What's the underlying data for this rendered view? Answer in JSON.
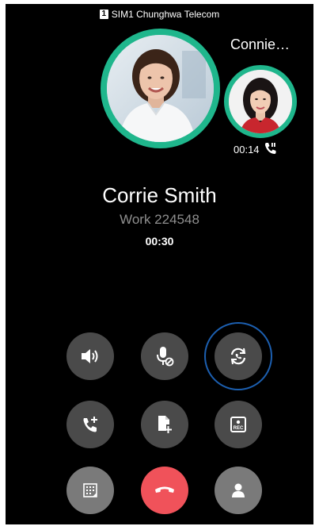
{
  "status_bar": {
    "sim_badge": "1",
    "carrier": "SIM1 Chunghwa Telecom"
  },
  "second_call": {
    "name": "Connie…",
    "timer": "00:14"
  },
  "main_call": {
    "name": "Corrie Smith",
    "number": "Work 224548",
    "timer": "00:30"
  },
  "colors": {
    "accent_ring": "#1fb68c",
    "button_bg": "#4a4a4a",
    "end_call": "#f0525a",
    "swap_ring": "#1c5fb0"
  },
  "buttons": [
    {
      "id": "speaker",
      "icon": "speaker-icon"
    },
    {
      "id": "mute",
      "icon": "mic-mute-icon"
    },
    {
      "id": "swap",
      "icon": "swap-call-icon"
    },
    {
      "id": "add-call",
      "icon": "add-call-icon"
    },
    {
      "id": "merge",
      "icon": "add-note-icon"
    },
    {
      "id": "record",
      "icon": "rec-icon",
      "label": "REC"
    },
    {
      "id": "dialpad",
      "icon": "dialpad-icon"
    },
    {
      "id": "end-call",
      "icon": "end-call-icon"
    },
    {
      "id": "contacts",
      "icon": "contact-icon"
    }
  ]
}
